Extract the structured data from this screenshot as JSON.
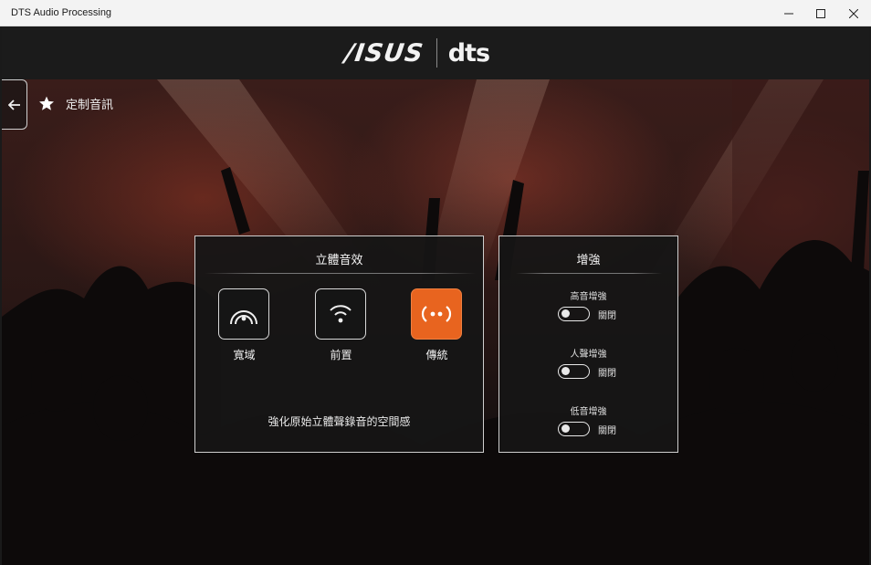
{
  "window": {
    "title": "DTS Audio Processing",
    "controls": [
      "minimize",
      "maximize",
      "close"
    ]
  },
  "header": {
    "brand_left": "/ISUS",
    "brand_right": "dts"
  },
  "nav": {
    "back_icon": "arrow-left-icon",
    "page_icon": "star-icon",
    "page_title": "定制音訊"
  },
  "surround": {
    "title": "立體音效",
    "modes": [
      {
        "label": "寬域",
        "icon": "headphone-arc-icon",
        "selected": false
      },
      {
        "label": "前置",
        "icon": "front-wave-icon",
        "selected": false
      },
      {
        "label": "傳統",
        "icon": "stereo-icon",
        "selected": true
      }
    ],
    "description": "強化原始立體聲錄音的空間感",
    "accent_color": "#e8641f"
  },
  "enhance": {
    "title": "增強",
    "items": [
      {
        "label": "高音增強",
        "state": "關閉",
        "on": false
      },
      {
        "label": "人聲增強",
        "state": "關閉",
        "on": false
      },
      {
        "label": "低音增強",
        "state": "關閉",
        "on": false
      }
    ]
  }
}
